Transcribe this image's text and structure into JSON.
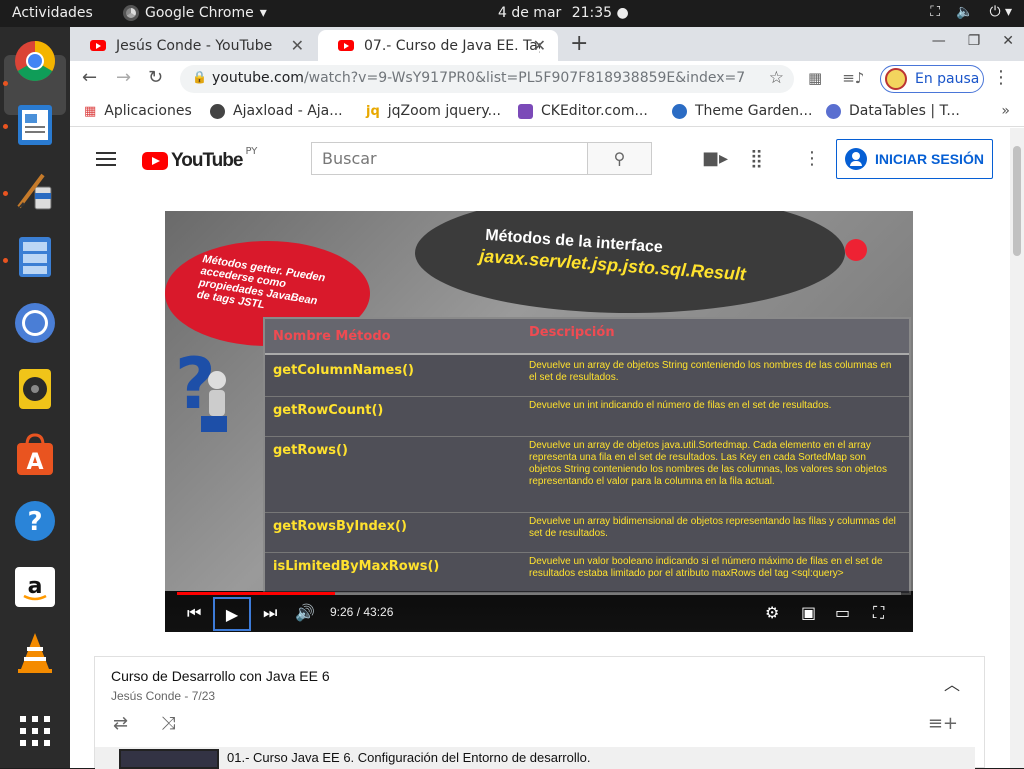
{
  "topbar": {
    "activities": "Actividades",
    "app_name": "Google Chrome",
    "date": "4 de mar",
    "time": "21:35"
  },
  "tabs": [
    {
      "title": "Jesús Conde - YouTube",
      "active": false
    },
    {
      "title": "07.- Curso de Java EE. Tag",
      "active": true
    }
  ],
  "toolbar": {
    "url_host": "youtube.com",
    "url_rest": "/watch?v=9-WsY917PR0&list=PL5F907F818938859E&index=7",
    "profile_label": "En pausa"
  },
  "bookmarks": [
    {
      "label": "Aplicaciones",
      "icon": "apps-grid-icon"
    },
    {
      "label": "Ajaxload - Aja...",
      "icon": "globe-icon"
    },
    {
      "label": "jqZoom jquery...",
      "icon": "jq-icon"
    },
    {
      "label": "CKEditor.com...",
      "icon": "ckeditor-icon"
    },
    {
      "label": "Theme Garden...",
      "icon": "theme-garden-icon"
    },
    {
      "label": "DataTables | T...",
      "icon": "datatables-icon"
    }
  ],
  "youtube": {
    "logo_word": "YouTube",
    "country": "PY",
    "search_placeholder": "Buscar",
    "signin_label": "INICIAR SESIÓN"
  },
  "video": {
    "slide_title": "Métodos de la interface",
    "slide_subtitle": "javax.servlet.jsp.jsto.sql.Result",
    "red_bubble_text": "Métodos getter. Pueden accederse como propiedades JavaBean de tags JSTL",
    "col_method": "Nombre Método",
    "col_desc": "Descripción",
    "rows": [
      {
        "method": "getColumnNames()",
        "desc": "Devuelve un array de objetos String conteniendo los nombres de las columnas en el set de resultados."
      },
      {
        "method": "getRowCount()",
        "desc": "Devuelve un int indicando el número de filas en el set de resultados."
      },
      {
        "method": "getRows()",
        "desc": "Devuelve un array de objetos java.util.Sortedmap. Cada elemento en el array representa una fila en el set de resultados. Las Key en cada SortedMap son objetos String conteniendo los nombres de las columnas, los valores son objetos representando el valor para la columna en la fila actual."
      },
      {
        "method": "getRowsByIndex()",
        "desc": "Devuelve un array bidimensional de objetos representando las filas y columnas del set de resultados."
      },
      {
        "method": "isLimitedByMaxRows()",
        "desc": "Devuelve un valor booleano indicando si el número máximo de filas en el set de resultados estaba limitado por el atributo maxRows del tag <sql:query>"
      }
    ],
    "time_display": "9:26 / 43:26",
    "progress_fraction": 0.218,
    "progress_color": "#ff0000"
  },
  "playlist": {
    "title": "Curso de Desarrollo con Java EE 6",
    "subtitle": "Jesús Conde - 7/23",
    "first_item": "01.- Curso Java EE 6. Configuración del Entorno de desarrollo."
  }
}
